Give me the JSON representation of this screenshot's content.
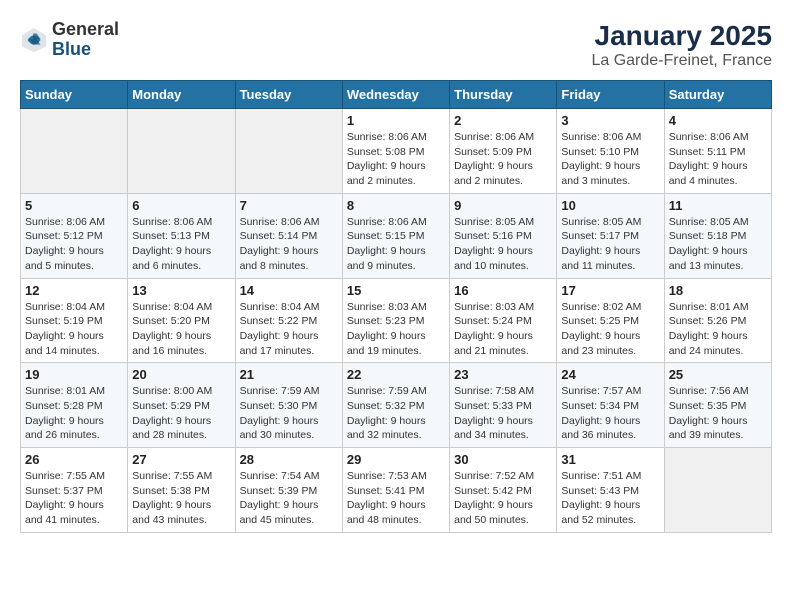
{
  "header": {
    "logo_general": "General",
    "logo_blue": "Blue",
    "title": "January 2025",
    "subtitle": "La Garde-Freinet, France"
  },
  "days_of_week": [
    "Sunday",
    "Monday",
    "Tuesday",
    "Wednesday",
    "Thursday",
    "Friday",
    "Saturday"
  ],
  "weeks": [
    [
      {
        "day": "",
        "info": ""
      },
      {
        "day": "",
        "info": ""
      },
      {
        "day": "",
        "info": ""
      },
      {
        "day": "1",
        "info": "Sunrise: 8:06 AM\nSunset: 5:08 PM\nDaylight: 9 hours and 2 minutes."
      },
      {
        "day": "2",
        "info": "Sunrise: 8:06 AM\nSunset: 5:09 PM\nDaylight: 9 hours and 2 minutes."
      },
      {
        "day": "3",
        "info": "Sunrise: 8:06 AM\nSunset: 5:10 PM\nDaylight: 9 hours and 3 minutes."
      },
      {
        "day": "4",
        "info": "Sunrise: 8:06 AM\nSunset: 5:11 PM\nDaylight: 9 hours and 4 minutes."
      }
    ],
    [
      {
        "day": "5",
        "info": "Sunrise: 8:06 AM\nSunset: 5:12 PM\nDaylight: 9 hours and 5 minutes."
      },
      {
        "day": "6",
        "info": "Sunrise: 8:06 AM\nSunset: 5:13 PM\nDaylight: 9 hours and 6 minutes."
      },
      {
        "day": "7",
        "info": "Sunrise: 8:06 AM\nSunset: 5:14 PM\nDaylight: 9 hours and 8 minutes."
      },
      {
        "day": "8",
        "info": "Sunrise: 8:06 AM\nSunset: 5:15 PM\nDaylight: 9 hours and 9 minutes."
      },
      {
        "day": "9",
        "info": "Sunrise: 8:05 AM\nSunset: 5:16 PM\nDaylight: 9 hours and 10 minutes."
      },
      {
        "day": "10",
        "info": "Sunrise: 8:05 AM\nSunset: 5:17 PM\nDaylight: 9 hours and 11 minutes."
      },
      {
        "day": "11",
        "info": "Sunrise: 8:05 AM\nSunset: 5:18 PM\nDaylight: 9 hours and 13 minutes."
      }
    ],
    [
      {
        "day": "12",
        "info": "Sunrise: 8:04 AM\nSunset: 5:19 PM\nDaylight: 9 hours and 14 minutes."
      },
      {
        "day": "13",
        "info": "Sunrise: 8:04 AM\nSunset: 5:20 PM\nDaylight: 9 hours and 16 minutes."
      },
      {
        "day": "14",
        "info": "Sunrise: 8:04 AM\nSunset: 5:22 PM\nDaylight: 9 hours and 17 minutes."
      },
      {
        "day": "15",
        "info": "Sunrise: 8:03 AM\nSunset: 5:23 PM\nDaylight: 9 hours and 19 minutes."
      },
      {
        "day": "16",
        "info": "Sunrise: 8:03 AM\nSunset: 5:24 PM\nDaylight: 9 hours and 21 minutes."
      },
      {
        "day": "17",
        "info": "Sunrise: 8:02 AM\nSunset: 5:25 PM\nDaylight: 9 hours and 23 minutes."
      },
      {
        "day": "18",
        "info": "Sunrise: 8:01 AM\nSunset: 5:26 PM\nDaylight: 9 hours and 24 minutes."
      }
    ],
    [
      {
        "day": "19",
        "info": "Sunrise: 8:01 AM\nSunset: 5:28 PM\nDaylight: 9 hours and 26 minutes."
      },
      {
        "day": "20",
        "info": "Sunrise: 8:00 AM\nSunset: 5:29 PM\nDaylight: 9 hours and 28 minutes."
      },
      {
        "day": "21",
        "info": "Sunrise: 7:59 AM\nSunset: 5:30 PM\nDaylight: 9 hours and 30 minutes."
      },
      {
        "day": "22",
        "info": "Sunrise: 7:59 AM\nSunset: 5:32 PM\nDaylight: 9 hours and 32 minutes."
      },
      {
        "day": "23",
        "info": "Sunrise: 7:58 AM\nSunset: 5:33 PM\nDaylight: 9 hours and 34 minutes."
      },
      {
        "day": "24",
        "info": "Sunrise: 7:57 AM\nSunset: 5:34 PM\nDaylight: 9 hours and 36 minutes."
      },
      {
        "day": "25",
        "info": "Sunrise: 7:56 AM\nSunset: 5:35 PM\nDaylight: 9 hours and 39 minutes."
      }
    ],
    [
      {
        "day": "26",
        "info": "Sunrise: 7:55 AM\nSunset: 5:37 PM\nDaylight: 9 hours and 41 minutes."
      },
      {
        "day": "27",
        "info": "Sunrise: 7:55 AM\nSunset: 5:38 PM\nDaylight: 9 hours and 43 minutes."
      },
      {
        "day": "28",
        "info": "Sunrise: 7:54 AM\nSunset: 5:39 PM\nDaylight: 9 hours and 45 minutes."
      },
      {
        "day": "29",
        "info": "Sunrise: 7:53 AM\nSunset: 5:41 PM\nDaylight: 9 hours and 48 minutes."
      },
      {
        "day": "30",
        "info": "Sunrise: 7:52 AM\nSunset: 5:42 PM\nDaylight: 9 hours and 50 minutes."
      },
      {
        "day": "31",
        "info": "Sunrise: 7:51 AM\nSunset: 5:43 PM\nDaylight: 9 hours and 52 minutes."
      },
      {
        "day": "",
        "info": ""
      }
    ]
  ]
}
